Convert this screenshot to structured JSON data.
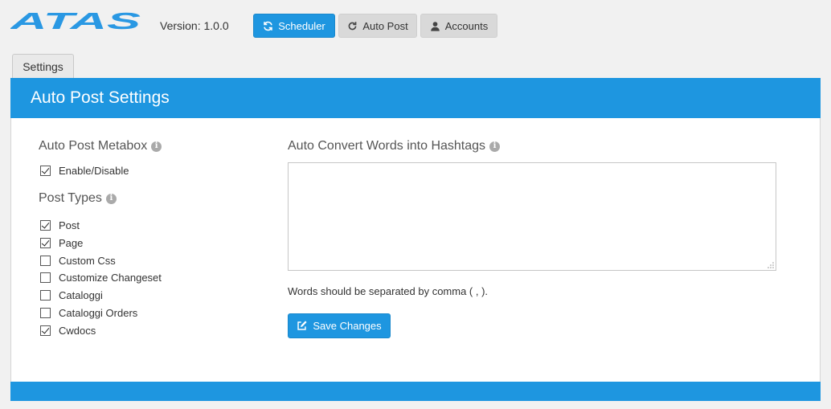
{
  "app": {
    "logo_text": "ATAS",
    "version": "Version: 1.0.0"
  },
  "nav": {
    "scheduler_label": "Scheduler",
    "autopost_label": "Auto Post",
    "accounts_label": "Accounts"
  },
  "tab": {
    "label": "Settings"
  },
  "panel": {
    "title": "Auto Post Settings",
    "metabox": {
      "title": "Auto Post Metabox",
      "enable_label": "Enable/Disable",
      "enable_checked": true
    },
    "post_types": {
      "title": "Post Types",
      "items": [
        {
          "label": "Post",
          "checked": true
        },
        {
          "label": "Page",
          "checked": true
        },
        {
          "label": "Custom Css",
          "checked": false
        },
        {
          "label": "Customize Changeset",
          "checked": false
        },
        {
          "label": "Cataloggi",
          "checked": false
        },
        {
          "label": "Cataloggi Orders",
          "checked": false
        },
        {
          "label": "Cwdocs",
          "checked": true
        }
      ]
    },
    "hashtags": {
      "title": "Auto Convert Words into Hashtags",
      "value": "",
      "hint": "Words should be separated by comma ( , )."
    },
    "save_label": "Save Changes"
  },
  "colors": {
    "accent": "#1e96e0",
    "background": "#f1f1f1"
  }
}
